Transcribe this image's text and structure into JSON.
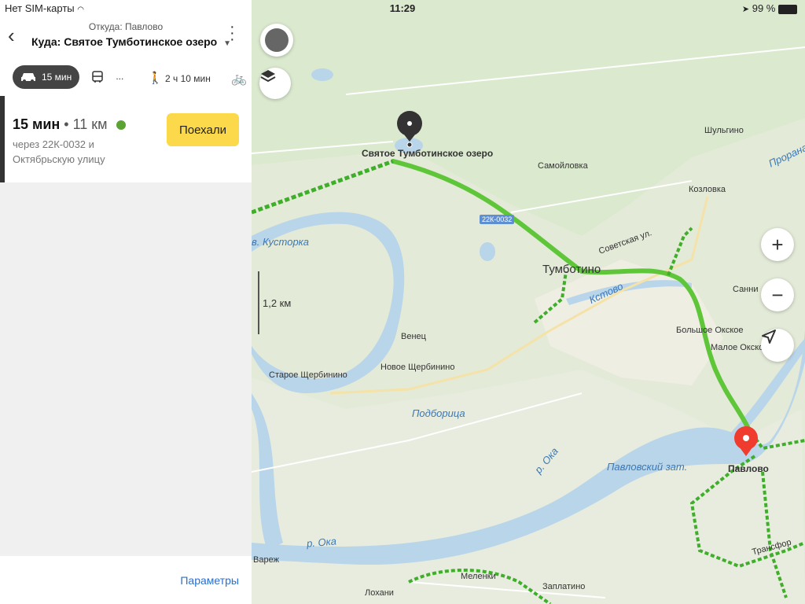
{
  "status_bar": {
    "carrier": "Нет SIM-карты",
    "time": "11:29",
    "battery": "99 %"
  },
  "header": {
    "from": "Откуда: Павлово",
    "to": "Куда: Святое Тумботинское озеро"
  },
  "transport_modes": {
    "car": "15 мин",
    "bus": "...",
    "walk": "2 ч 10 мин"
  },
  "route": {
    "duration": "15 мин",
    "separator": "•",
    "distance": "11 км",
    "via": "через 22К-0032 и Октябрьскую улицу",
    "go_label": "Поехали"
  },
  "footer": {
    "params_label": "Параметры"
  },
  "map": {
    "scale_label": "1,2 км",
    "road_badge": "22К-0032",
    "places": {
      "destination": "Святое Тумботинское озеро",
      "shulgino": "Шульгино",
      "samoylovka": "Самойловка",
      "kozlovka": "Козловка",
      "tumbotino": "Тумботино",
      "sovetskaya": "Советская ул.",
      "bolshoe_okskoe": "Большое Окское",
      "maloe_okskoe": "Малое Окское",
      "sannitsy": "Санни",
      "venets": "Венец",
      "staroe": "Старое Щербинино",
      "novoe": "Новое Щербинино",
      "pavlovo": "Павлово",
      "varezh": "Вареж",
      "melenki": "Меленки",
      "zaplatino": "Заплатино",
      "lokhani": "Лохани",
      "transformatornaya": "Трансфор"
    },
    "water": {
      "kustorka": "в. Кусторка",
      "podboritsa": "Подборица",
      "oka1": "р. Ока",
      "oka2": "р. Ока",
      "pavlovsky_zat": "Павловский зат.",
      "kstovo": "Кстово",
      "prorana": "Прорана"
    }
  },
  "colors": {
    "route": "#5fc63a",
    "accent_button": "#fcd94a",
    "link": "#2a6fce",
    "water": "#b9d5ea"
  }
}
